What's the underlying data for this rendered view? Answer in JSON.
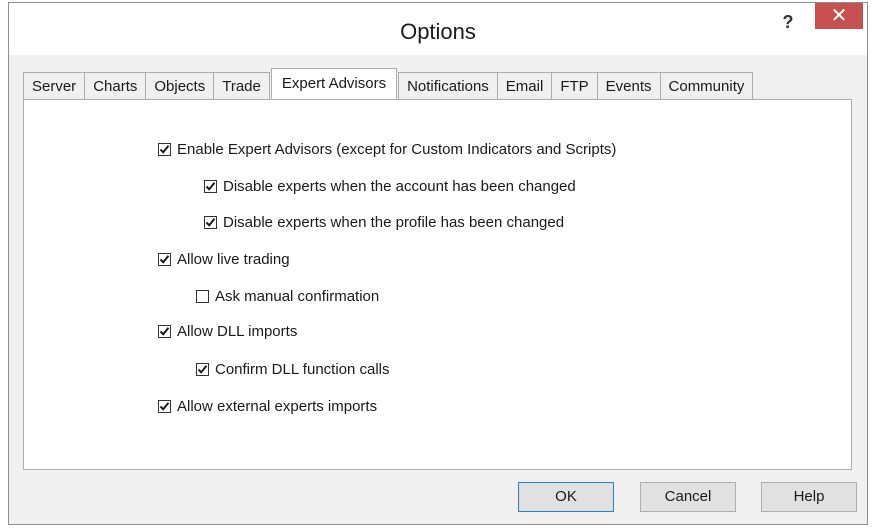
{
  "window": {
    "title": "Options",
    "help_label": "?",
    "close_label": "✕"
  },
  "tabs": [
    {
      "label": "Server",
      "active": false
    },
    {
      "label": "Charts",
      "active": false
    },
    {
      "label": "Objects",
      "active": false
    },
    {
      "label": "Trade",
      "active": false
    },
    {
      "label": "Expert Advisors",
      "active": true
    },
    {
      "label": "Notifications",
      "active": false
    },
    {
      "label": "Email",
      "active": false
    },
    {
      "label": "FTP",
      "active": false
    },
    {
      "label": "Events",
      "active": false
    },
    {
      "label": "Community",
      "active": false
    }
  ],
  "options": {
    "enable_experts": {
      "label": "Enable Expert Advisors (except for Custom Indicators and Scripts)",
      "checked": true
    },
    "disable_on_account": {
      "label": "Disable experts when the account has been changed",
      "checked": true
    },
    "disable_on_profile": {
      "label": "Disable experts when the profile has been changed",
      "checked": true
    },
    "allow_live": {
      "label": "Allow live trading",
      "checked": true
    },
    "ask_manual": {
      "label": "Ask manual confirmation",
      "checked": false
    },
    "allow_dll": {
      "label": "Allow DLL imports",
      "checked": true
    },
    "confirm_dll": {
      "label": "Confirm DLL function calls",
      "checked": true
    },
    "allow_external": {
      "label": "Allow external experts imports",
      "checked": true
    }
  },
  "footer": {
    "ok_label": "OK",
    "cancel_label": "Cancel",
    "help_label": "Help"
  },
  "colors": {
    "close_button": "#c75050",
    "dialog_background": "#f0f0f0",
    "panel_background": "#ffffff"
  }
}
